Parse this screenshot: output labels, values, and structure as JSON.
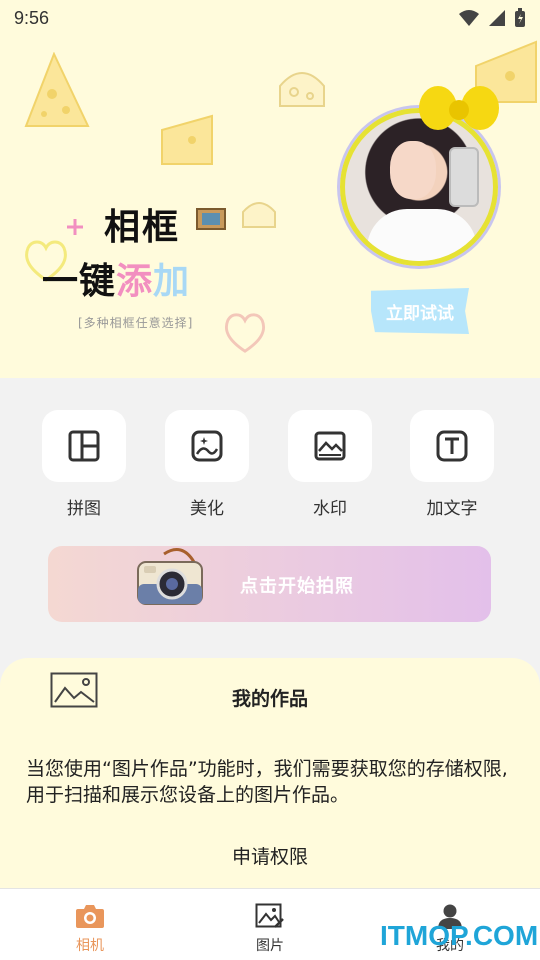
{
  "status_bar": {
    "time": "9:56",
    "icons": [
      "wifi-icon",
      "signal-icon",
      "battery-icon"
    ]
  },
  "banner": {
    "title_main": "相框",
    "title_sub_1": "一键",
    "title_sub_2": "添",
    "title_sub_3": "加",
    "note": "[多种相框任意选择]",
    "try_button": "立即试试"
  },
  "tools": [
    {
      "label": "拼图",
      "icon": "collage-icon"
    },
    {
      "label": "美化",
      "icon": "beautify-icon"
    },
    {
      "label": "水印",
      "icon": "watermark-icon"
    },
    {
      "label": "加文字",
      "icon": "text-icon"
    }
  ],
  "camera_banner": {
    "label": "点击开始拍照"
  },
  "works": {
    "title": "我的作品",
    "description": "当您使用“图片作品”功能时，我们需要获取您的存储权限,用于扫描和展示您设备上的图片作品。",
    "permission_button": "申请权限"
  },
  "bottom_nav": [
    {
      "label": "相机",
      "active": true
    },
    {
      "label": "图片",
      "active": false
    },
    {
      "label": "我的",
      "active": false
    }
  ],
  "watermark": "ITMOP.COM",
  "colors": {
    "accent": "#e9965b",
    "banner_bg": "#fffbdc",
    "try_button": "#b7e6fb"
  }
}
